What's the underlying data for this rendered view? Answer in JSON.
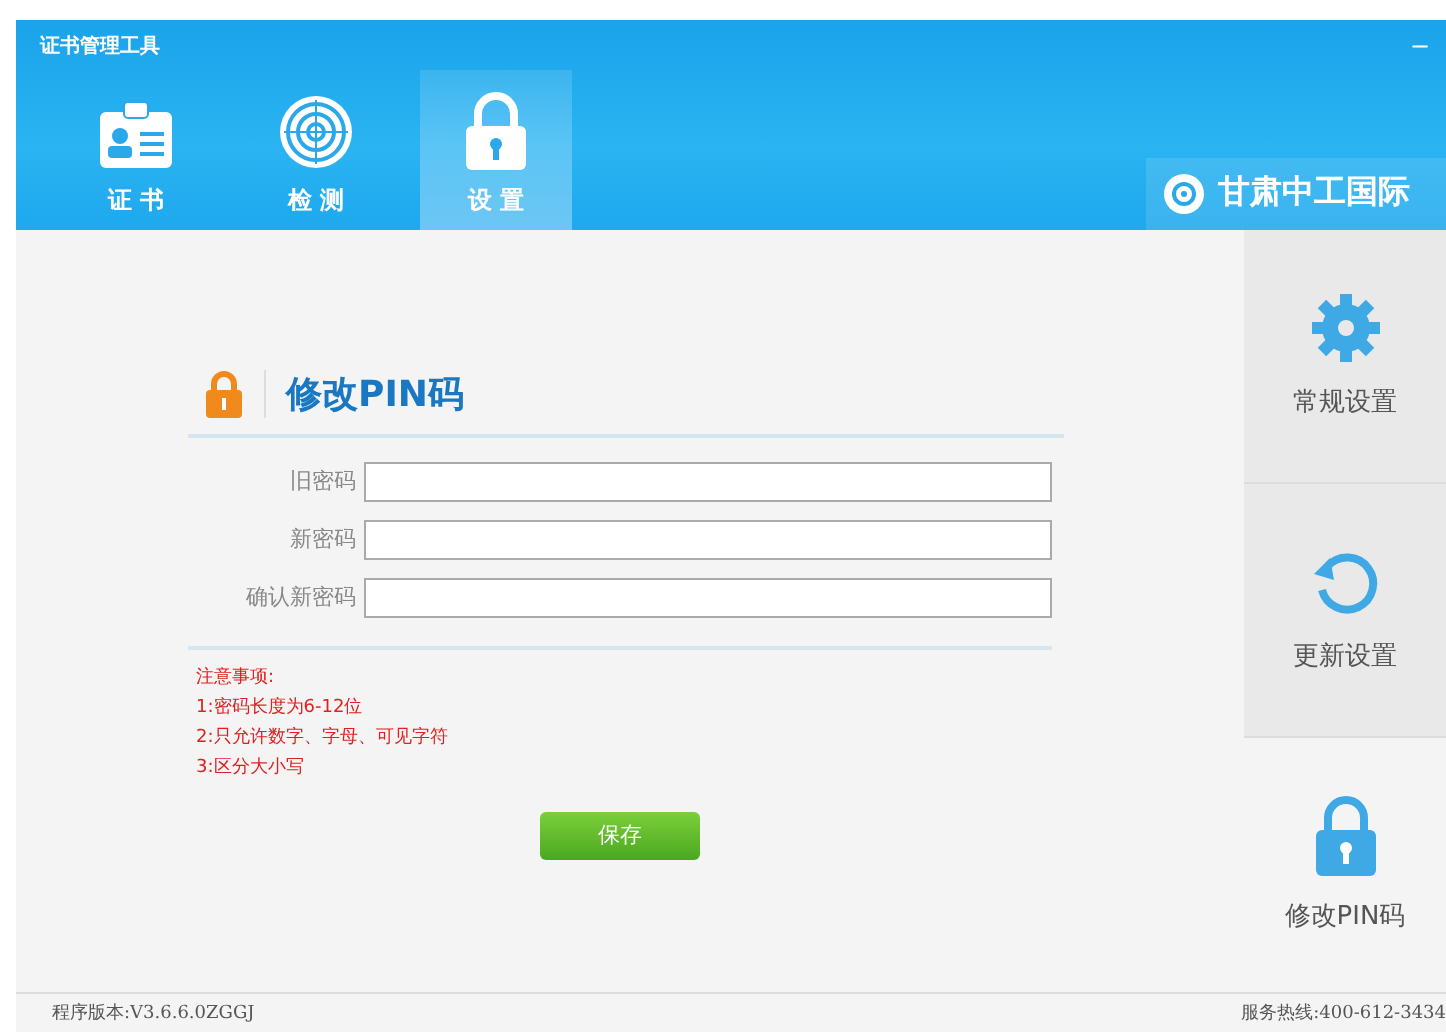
{
  "window": {
    "title": "证书管理工具",
    "controls": [
      "−"
    ]
  },
  "tabs": [
    {
      "label": "证 书",
      "selected": false
    },
    {
      "label": "检 测",
      "selected": false
    },
    {
      "label": "设 置",
      "selected": true
    }
  ],
  "brand": "甘肃中工国际",
  "form": {
    "title": "修改PIN码",
    "fields": [
      {
        "label": "旧密码"
      },
      {
        "label": "新密码"
      },
      {
        "label": "确认新密码"
      }
    ],
    "notes": [
      "注意事项:",
      "1:密码长度为6-12位",
      "2:只允许数字、字母、可见字符",
      "3:区分大小写"
    ],
    "save_button": "保存"
  },
  "sidebar": [
    {
      "label": "常规设置",
      "selected": false
    },
    {
      "label": "更新设置",
      "selected": false
    },
    {
      "label": "修改PIN码",
      "selected": true
    }
  ],
  "status_bar": {
    "version": "程序版本:V3.6.6.0ZGGJ",
    "hotline": "服务热线:400-612-3434"
  }
}
